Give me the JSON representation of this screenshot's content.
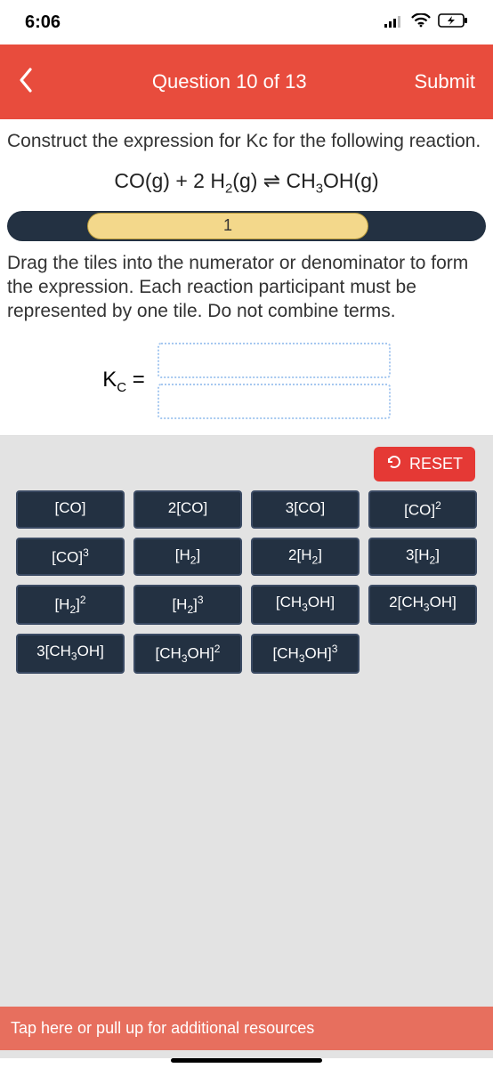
{
  "status": {
    "time": "6:06"
  },
  "header": {
    "title": "Question 10 of 13",
    "submit": "Submit"
  },
  "instr1": "Construct the expression for Kc for the following reaction.",
  "equation": {
    "lhs_co": "CO(g) + 2 H",
    "h2_sub": "2",
    "mid": "(g) ",
    "rhs": " CH",
    "ch3_sub": "3",
    "oh": "OH(g)"
  },
  "progress": {
    "label": "1"
  },
  "instr2": "Drag the tiles into the numerator or denominator to form the expression. Each reaction participant must be represented by one tile. Do not combine terms.",
  "kc": {
    "label_k": "K",
    "label_c": "C",
    "equals": " ="
  },
  "reset": {
    "label": "RESET"
  },
  "tiles": [
    {
      "html": "[CO]"
    },
    {
      "html": "2[CO]"
    },
    {
      "html": "3[CO]"
    },
    {
      "html": "[CO]<span class='sup'>2</span>"
    },
    {
      "html": "[CO]<span class='sup'>3</span>"
    },
    {
      "html": "[H<span class='sub'>2</span>]"
    },
    {
      "html": "2[H<span class='sub'>2</span>]"
    },
    {
      "html": "3[H<span class='sub'>2</span>]"
    },
    {
      "html": "[H<span class='sub'>2</span>]<span class='sup'>2</span>"
    },
    {
      "html": "[H<span class='sub'>2</span>]<span class='sup'>3</span>"
    },
    {
      "html": "[CH<span class='sub'>3</span>OH]"
    },
    {
      "html": "2[CH<span class='sub'>3</span>OH]"
    },
    {
      "html": "3[CH<span class='sub'>3</span>OH]"
    },
    {
      "html": "[CH<span class='sub'>3</span>OH]<span class='sup'>2</span>"
    },
    {
      "html": "[CH<span class='sub'>3</span>OH]<span class='sup'>3</span>"
    }
  ],
  "bottom": {
    "text": "Tap here or pull up for additional resources"
  }
}
